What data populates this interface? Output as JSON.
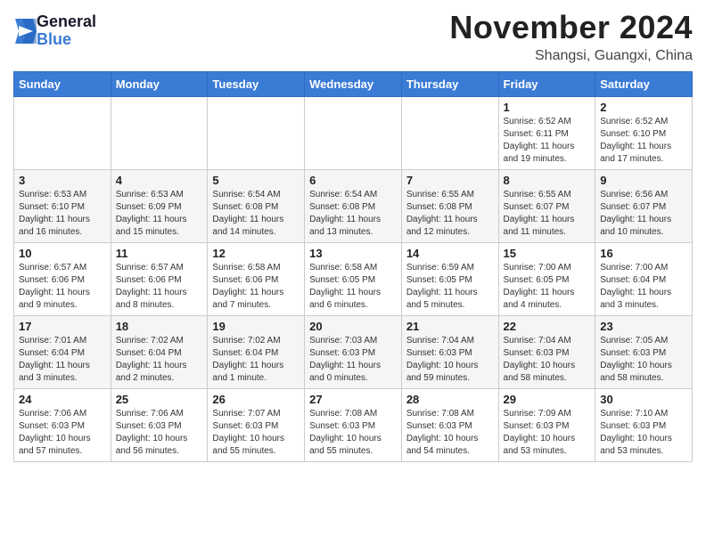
{
  "header": {
    "logo_line1": "General",
    "logo_line2": "Blue",
    "month": "November 2024",
    "location": "Shangsi, Guangxi, China"
  },
  "weekdays": [
    "Sunday",
    "Monday",
    "Tuesday",
    "Wednesday",
    "Thursday",
    "Friday",
    "Saturday"
  ],
  "weeks": [
    [
      {
        "day": "",
        "info": ""
      },
      {
        "day": "",
        "info": ""
      },
      {
        "day": "",
        "info": ""
      },
      {
        "day": "",
        "info": ""
      },
      {
        "day": "",
        "info": ""
      },
      {
        "day": "1",
        "info": "Sunrise: 6:52 AM\nSunset: 6:11 PM\nDaylight: 11 hours and 19 minutes."
      },
      {
        "day": "2",
        "info": "Sunrise: 6:52 AM\nSunset: 6:10 PM\nDaylight: 11 hours and 17 minutes."
      }
    ],
    [
      {
        "day": "3",
        "info": "Sunrise: 6:53 AM\nSunset: 6:10 PM\nDaylight: 11 hours and 16 minutes."
      },
      {
        "day": "4",
        "info": "Sunrise: 6:53 AM\nSunset: 6:09 PM\nDaylight: 11 hours and 15 minutes."
      },
      {
        "day": "5",
        "info": "Sunrise: 6:54 AM\nSunset: 6:08 PM\nDaylight: 11 hours and 14 minutes."
      },
      {
        "day": "6",
        "info": "Sunrise: 6:54 AM\nSunset: 6:08 PM\nDaylight: 11 hours and 13 minutes."
      },
      {
        "day": "7",
        "info": "Sunrise: 6:55 AM\nSunset: 6:08 PM\nDaylight: 11 hours and 12 minutes."
      },
      {
        "day": "8",
        "info": "Sunrise: 6:55 AM\nSunset: 6:07 PM\nDaylight: 11 hours and 11 minutes."
      },
      {
        "day": "9",
        "info": "Sunrise: 6:56 AM\nSunset: 6:07 PM\nDaylight: 11 hours and 10 minutes."
      }
    ],
    [
      {
        "day": "10",
        "info": "Sunrise: 6:57 AM\nSunset: 6:06 PM\nDaylight: 11 hours and 9 minutes."
      },
      {
        "day": "11",
        "info": "Sunrise: 6:57 AM\nSunset: 6:06 PM\nDaylight: 11 hours and 8 minutes."
      },
      {
        "day": "12",
        "info": "Sunrise: 6:58 AM\nSunset: 6:06 PM\nDaylight: 11 hours and 7 minutes."
      },
      {
        "day": "13",
        "info": "Sunrise: 6:58 AM\nSunset: 6:05 PM\nDaylight: 11 hours and 6 minutes."
      },
      {
        "day": "14",
        "info": "Sunrise: 6:59 AM\nSunset: 6:05 PM\nDaylight: 11 hours and 5 minutes."
      },
      {
        "day": "15",
        "info": "Sunrise: 7:00 AM\nSunset: 6:05 PM\nDaylight: 11 hours and 4 minutes."
      },
      {
        "day": "16",
        "info": "Sunrise: 7:00 AM\nSunset: 6:04 PM\nDaylight: 11 hours and 3 minutes."
      }
    ],
    [
      {
        "day": "17",
        "info": "Sunrise: 7:01 AM\nSunset: 6:04 PM\nDaylight: 11 hours and 3 minutes."
      },
      {
        "day": "18",
        "info": "Sunrise: 7:02 AM\nSunset: 6:04 PM\nDaylight: 11 hours and 2 minutes."
      },
      {
        "day": "19",
        "info": "Sunrise: 7:02 AM\nSunset: 6:04 PM\nDaylight: 11 hours and 1 minute."
      },
      {
        "day": "20",
        "info": "Sunrise: 7:03 AM\nSunset: 6:03 PM\nDaylight: 11 hours and 0 minutes."
      },
      {
        "day": "21",
        "info": "Sunrise: 7:04 AM\nSunset: 6:03 PM\nDaylight: 10 hours and 59 minutes."
      },
      {
        "day": "22",
        "info": "Sunrise: 7:04 AM\nSunset: 6:03 PM\nDaylight: 10 hours and 58 minutes."
      },
      {
        "day": "23",
        "info": "Sunrise: 7:05 AM\nSunset: 6:03 PM\nDaylight: 10 hours and 58 minutes."
      }
    ],
    [
      {
        "day": "24",
        "info": "Sunrise: 7:06 AM\nSunset: 6:03 PM\nDaylight: 10 hours and 57 minutes."
      },
      {
        "day": "25",
        "info": "Sunrise: 7:06 AM\nSunset: 6:03 PM\nDaylight: 10 hours and 56 minutes."
      },
      {
        "day": "26",
        "info": "Sunrise: 7:07 AM\nSunset: 6:03 PM\nDaylight: 10 hours and 55 minutes."
      },
      {
        "day": "27",
        "info": "Sunrise: 7:08 AM\nSunset: 6:03 PM\nDaylight: 10 hours and 55 minutes."
      },
      {
        "day": "28",
        "info": "Sunrise: 7:08 AM\nSunset: 6:03 PM\nDaylight: 10 hours and 54 minutes."
      },
      {
        "day": "29",
        "info": "Sunrise: 7:09 AM\nSunset: 6:03 PM\nDaylight: 10 hours and 53 minutes."
      },
      {
        "day": "30",
        "info": "Sunrise: 7:10 AM\nSunset: 6:03 PM\nDaylight: 10 hours and 53 minutes."
      }
    ]
  ]
}
